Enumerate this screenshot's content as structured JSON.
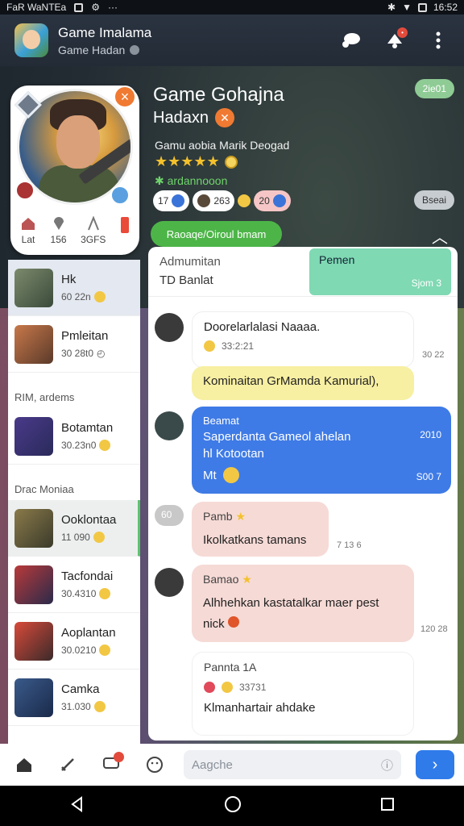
{
  "status": {
    "left_text": "FaR WaNTEa",
    "time": "16:52"
  },
  "appbar": {
    "title": "Game Imalama",
    "subtitle": "Game Hadan"
  },
  "game": {
    "title": "Game Gohajna",
    "subtitle": "Hadaxn",
    "description": "Gamu aobia Marik Deogad",
    "rating_icon": "star-rating",
    "green_line": "✱ ardannooon",
    "chips": [
      "17",
      "263",
      "20"
    ],
    "pill_top": "2ie01",
    "pill_mid": "Bseai",
    "action_label": "Raoaqe/Oiroul bmam"
  },
  "profile": {
    "stat1": "Lat",
    "stat2": "156",
    "stat3": "3GFS"
  },
  "list": {
    "items": [
      {
        "name": "Hk",
        "count": "60 22n"
      },
      {
        "name": "Pmleitan",
        "count": "30 28t0"
      }
    ],
    "section1": "RIM, ardems",
    "items2": [
      {
        "name": "Botamtan",
        "count": "30.23n0"
      }
    ],
    "section2": "Drac Moniaa",
    "items3": [
      {
        "name": "Ooklontaa",
        "count": "11 090"
      },
      {
        "name": "Tacfondai",
        "count": "30.4310"
      },
      {
        "name": "Aoplantan",
        "count": "30.0210"
      },
      {
        "name": "Camka",
        "count": "31.030"
      }
    ]
  },
  "chat": {
    "head1": "Admumitan",
    "head2": "TD Banlat",
    "mint_title": "Pemen",
    "mint_sub": "Sjom 3",
    "m1": {
      "text": "Doorelarlalasi Naaaa.",
      "sub": "33:2:21",
      "time": "30 22"
    },
    "m2": {
      "text": "Kominaitan GrMamda Kamurial),"
    },
    "m3": {
      "name": "Beamat",
      "line1": "Saperdanta Gameol ahelan",
      "line2": "hl Kotootan",
      "line3": "Mt",
      "time1": "2010",
      "time2": "S00 7"
    },
    "m4": {
      "side": "60",
      "name": "Pamb",
      "text": "Ikolkatkans tamans",
      "time": "7 13 6"
    },
    "m5": {
      "name": "Bamao",
      "text": "Alhhehkan kastatalkar maer pest nick",
      "time": "120 28"
    },
    "m6": {
      "title": "Pannta 1A",
      "sub": "33731",
      "text": "Klmanhartair ahdake"
    }
  },
  "input": {
    "placeholder": "Aagche"
  }
}
